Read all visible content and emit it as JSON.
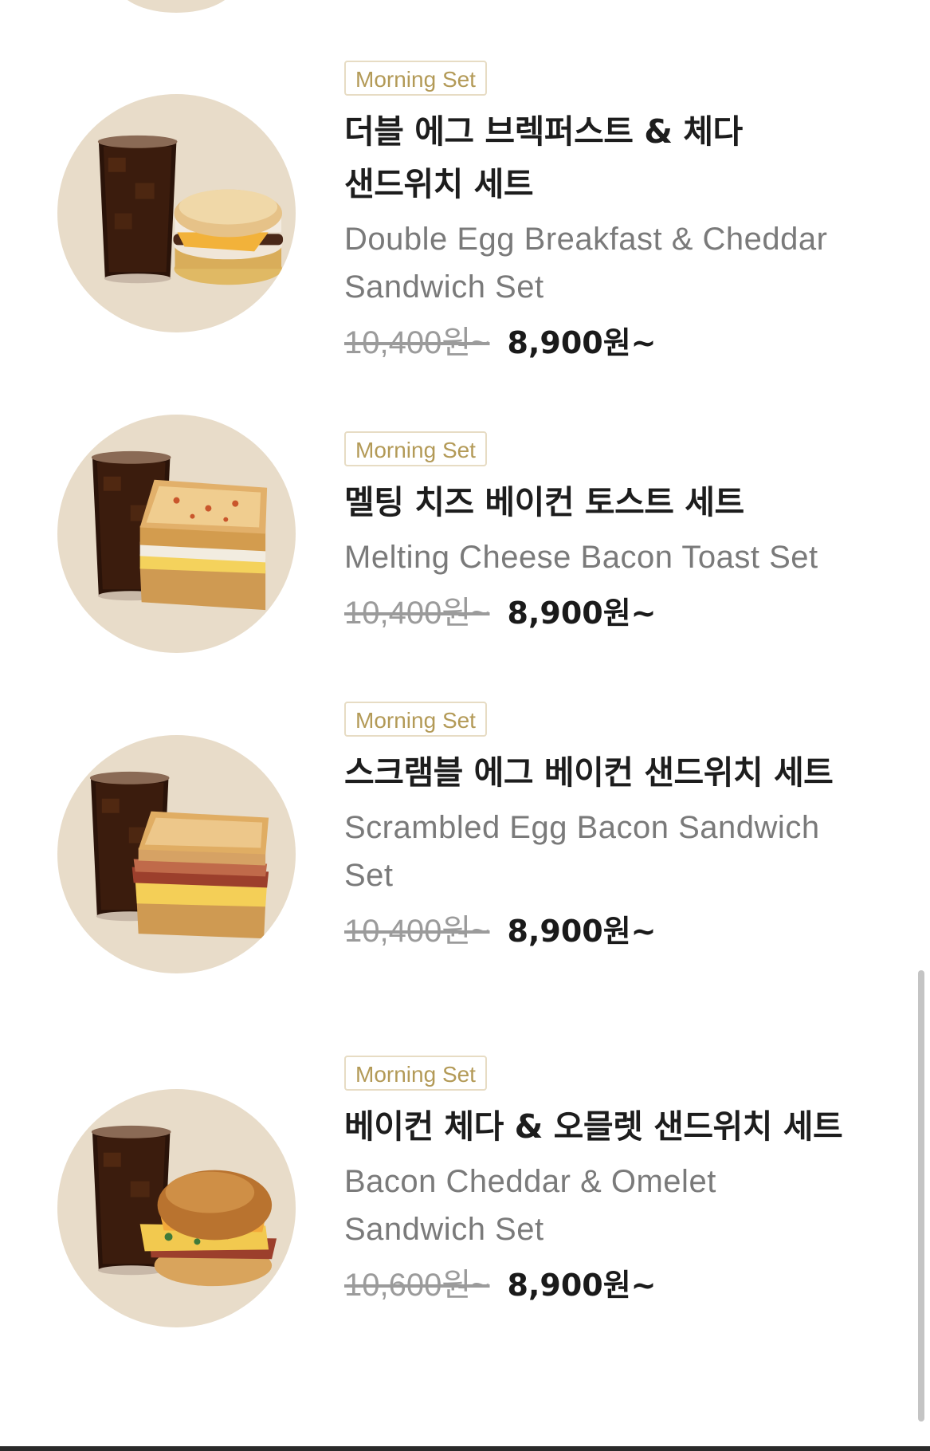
{
  "menu_items": [
    {
      "badge": "Morning Set",
      "name_ko": "더블 에그 브렉퍼스트 & 체다 샌드위치 세트",
      "name_en": "Double Egg Breakfast & Cheddar Sandwich Set",
      "price_original": "10,400원~",
      "price_sale": "8,900원~",
      "image": "iced-americano-and-english-muffin-image"
    },
    {
      "badge": "Morning Set",
      "name_ko": "멜팅 치즈 베이컨 토스트 세트",
      "name_en": "Melting Cheese Bacon Toast Set",
      "price_original": "10,400원~",
      "price_sale": "8,900원~",
      "image": "iced-americano-and-cheese-toast-image"
    },
    {
      "badge": "Morning Set",
      "name_ko": "스크램블 에그 베이컨 샌드위치 세트",
      "name_en": "Scrambled Egg Bacon Sandwich Set",
      "price_original": "10,400원~",
      "price_sale": "8,900원~",
      "image": "iced-americano-and-bacon-sandwich-image"
    },
    {
      "badge": "Morning Set",
      "name_ko": "베이컨 체다 & 오믈렛 샌드위치 세트",
      "name_en": "Bacon Cheddar & Omelet Sandwich Set",
      "price_original": "10,600원~",
      "price_sale": "8,900원~",
      "image": "iced-americano-and-brioche-omelet-image"
    }
  ],
  "colors": {
    "thumb_background": "#e8dcc9",
    "badge_text": "#b39a57",
    "badge_border": "#e7dcc4",
    "name_en": "#7a7a7a",
    "price_original": "#9b9b9b",
    "price_sale": "#1a1a1a"
  }
}
